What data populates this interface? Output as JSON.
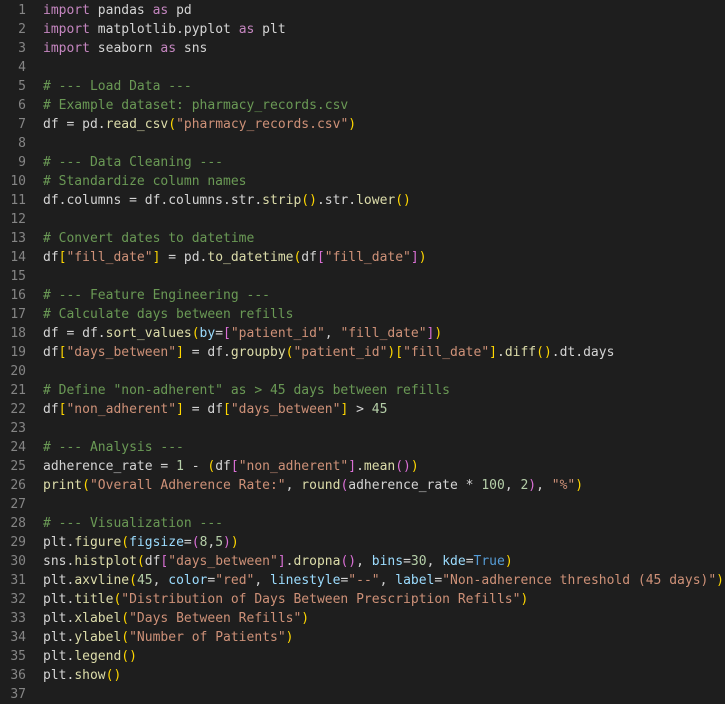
{
  "editor": {
    "lines": [
      {
        "number": "1",
        "tokens": [
          {
            "t": "import",
            "c": "keyword"
          },
          {
            "t": " pandas ",
            "c": "plain"
          },
          {
            "t": "as",
            "c": "keyword"
          },
          {
            "t": " pd",
            "c": "plain"
          }
        ]
      },
      {
        "number": "2",
        "tokens": [
          {
            "t": "import",
            "c": "keyword"
          },
          {
            "t": " matplotlib.pyplot ",
            "c": "plain"
          },
          {
            "t": "as",
            "c": "keyword"
          },
          {
            "t": " plt",
            "c": "plain"
          }
        ]
      },
      {
        "number": "3",
        "tokens": [
          {
            "t": "import",
            "c": "keyword"
          },
          {
            "t": " seaborn ",
            "c": "plain"
          },
          {
            "t": "as",
            "c": "keyword"
          },
          {
            "t": " sns",
            "c": "plain"
          }
        ]
      },
      {
        "number": "4",
        "tokens": []
      },
      {
        "number": "5",
        "tokens": [
          {
            "t": "# --- Load Data ---",
            "c": "comment"
          }
        ]
      },
      {
        "number": "6",
        "tokens": [
          {
            "t": "# Example dataset: pharmacy_records.csv",
            "c": "comment"
          }
        ]
      },
      {
        "number": "7",
        "tokens": [
          {
            "t": "df = pd.",
            "c": "plain"
          },
          {
            "t": "read_csv",
            "c": "function"
          },
          {
            "t": "(",
            "c": "bracket1"
          },
          {
            "t": "\"pharmacy_records.csv\"",
            "c": "string"
          },
          {
            "t": ")",
            "c": "bracket1"
          }
        ]
      },
      {
        "number": "8",
        "tokens": []
      },
      {
        "number": "9",
        "tokens": [
          {
            "t": "# --- Data Cleaning ---",
            "c": "comment"
          }
        ]
      },
      {
        "number": "10",
        "tokens": [
          {
            "t": "# Standardize column names",
            "c": "comment"
          }
        ]
      },
      {
        "number": "11",
        "tokens": [
          {
            "t": "df.columns = df.columns.str.",
            "c": "plain"
          },
          {
            "t": "strip",
            "c": "function"
          },
          {
            "t": "()",
            "c": "bracket1"
          },
          {
            "t": ".str.",
            "c": "plain"
          },
          {
            "t": "lower",
            "c": "function"
          },
          {
            "t": "()",
            "c": "bracket1"
          }
        ]
      },
      {
        "number": "12",
        "tokens": []
      },
      {
        "number": "13",
        "tokens": [
          {
            "t": "# Convert dates to datetime",
            "c": "comment"
          }
        ]
      },
      {
        "number": "14",
        "tokens": [
          {
            "t": "df",
            "c": "plain"
          },
          {
            "t": "[",
            "c": "bracket1"
          },
          {
            "t": "\"fill_date\"",
            "c": "string"
          },
          {
            "t": "]",
            "c": "bracket1"
          },
          {
            "t": " = pd.",
            "c": "plain"
          },
          {
            "t": "to_datetime",
            "c": "function"
          },
          {
            "t": "(",
            "c": "bracket1"
          },
          {
            "t": "df",
            "c": "plain"
          },
          {
            "t": "[",
            "c": "bracket2"
          },
          {
            "t": "\"fill_date\"",
            "c": "string"
          },
          {
            "t": "]",
            "c": "bracket2"
          },
          {
            "t": ")",
            "c": "bracket1"
          }
        ]
      },
      {
        "number": "15",
        "tokens": []
      },
      {
        "number": "16",
        "tokens": [
          {
            "t": "# --- Feature Engineering ---",
            "c": "comment"
          }
        ]
      },
      {
        "number": "17",
        "tokens": [
          {
            "t": "# Calculate days between refills",
            "c": "comment"
          }
        ]
      },
      {
        "number": "18",
        "tokens": [
          {
            "t": "df = df.",
            "c": "plain"
          },
          {
            "t": "sort_values",
            "c": "function"
          },
          {
            "t": "(",
            "c": "bracket1"
          },
          {
            "t": "by",
            "c": "variable"
          },
          {
            "t": "=",
            "c": "plain"
          },
          {
            "t": "[",
            "c": "bracket2"
          },
          {
            "t": "\"patient_id\"",
            "c": "string"
          },
          {
            "t": ", ",
            "c": "plain"
          },
          {
            "t": "\"fill_date\"",
            "c": "string"
          },
          {
            "t": "]",
            "c": "bracket2"
          },
          {
            "t": ")",
            "c": "bracket1"
          }
        ]
      },
      {
        "number": "19",
        "tokens": [
          {
            "t": "df",
            "c": "plain"
          },
          {
            "t": "[",
            "c": "bracket1"
          },
          {
            "t": "\"days_between\"",
            "c": "string"
          },
          {
            "t": "]",
            "c": "bracket1"
          },
          {
            "t": " = df.",
            "c": "plain"
          },
          {
            "t": "groupby",
            "c": "function"
          },
          {
            "t": "(",
            "c": "bracket1"
          },
          {
            "t": "\"patient_id\"",
            "c": "string"
          },
          {
            "t": ")",
            "c": "bracket1"
          },
          {
            "t": "[",
            "c": "bracket1"
          },
          {
            "t": "\"fill_date\"",
            "c": "string"
          },
          {
            "t": "]",
            "c": "bracket1"
          },
          {
            "t": ".",
            "c": "plain"
          },
          {
            "t": "diff",
            "c": "function"
          },
          {
            "t": "()",
            "c": "bracket1"
          },
          {
            "t": ".dt.days",
            "c": "plain"
          }
        ]
      },
      {
        "number": "20",
        "tokens": []
      },
      {
        "number": "21",
        "tokens": [
          {
            "t": "# Define \"non-adherent\" as > 45 days between refills",
            "c": "comment"
          }
        ]
      },
      {
        "number": "22",
        "tokens": [
          {
            "t": "df",
            "c": "plain"
          },
          {
            "t": "[",
            "c": "bracket1"
          },
          {
            "t": "\"non_adherent\"",
            "c": "string"
          },
          {
            "t": "]",
            "c": "bracket1"
          },
          {
            "t": " = df",
            "c": "plain"
          },
          {
            "t": "[",
            "c": "bracket1"
          },
          {
            "t": "\"days_between\"",
            "c": "string"
          },
          {
            "t": "]",
            "c": "bracket1"
          },
          {
            "t": " > ",
            "c": "plain"
          },
          {
            "t": "45",
            "c": "number"
          }
        ]
      },
      {
        "number": "23",
        "tokens": []
      },
      {
        "number": "24",
        "tokens": [
          {
            "t": "# --- Analysis ---",
            "c": "comment"
          }
        ]
      },
      {
        "number": "25",
        "tokens": [
          {
            "t": "adherence_rate = ",
            "c": "plain"
          },
          {
            "t": "1",
            "c": "number"
          },
          {
            "t": " - ",
            "c": "plain"
          },
          {
            "t": "(",
            "c": "bracket1"
          },
          {
            "t": "df",
            "c": "plain"
          },
          {
            "t": "[",
            "c": "bracket2"
          },
          {
            "t": "\"non_adherent\"",
            "c": "string"
          },
          {
            "t": "]",
            "c": "bracket2"
          },
          {
            "t": ".",
            "c": "plain"
          },
          {
            "t": "mean",
            "c": "function"
          },
          {
            "t": "()",
            "c": "bracket2"
          },
          {
            "t": ")",
            "c": "bracket1"
          }
        ]
      },
      {
        "number": "26",
        "tokens": [
          {
            "t": "print",
            "c": "function"
          },
          {
            "t": "(",
            "c": "bracket1"
          },
          {
            "t": "\"Overall Adherence Rate:\"",
            "c": "string"
          },
          {
            "t": ", ",
            "c": "plain"
          },
          {
            "t": "round",
            "c": "function"
          },
          {
            "t": "(",
            "c": "bracket2"
          },
          {
            "t": "adherence_rate * ",
            "c": "plain"
          },
          {
            "t": "100",
            "c": "number"
          },
          {
            "t": ", ",
            "c": "plain"
          },
          {
            "t": "2",
            "c": "number"
          },
          {
            "t": ")",
            "c": "bracket2"
          },
          {
            "t": ", ",
            "c": "plain"
          },
          {
            "t": "\"%\"",
            "c": "string"
          },
          {
            "t": ")",
            "c": "bracket1"
          }
        ]
      },
      {
        "number": "27",
        "tokens": []
      },
      {
        "number": "28",
        "tokens": [
          {
            "t": "# --- Visualization ---",
            "c": "comment"
          }
        ]
      },
      {
        "number": "29",
        "tokens": [
          {
            "t": "plt.",
            "c": "plain"
          },
          {
            "t": "figure",
            "c": "function"
          },
          {
            "t": "(",
            "c": "bracket1"
          },
          {
            "t": "figsize",
            "c": "variable"
          },
          {
            "t": "=",
            "c": "plain"
          },
          {
            "t": "(",
            "c": "bracket2"
          },
          {
            "t": "8",
            "c": "number"
          },
          {
            "t": ",",
            "c": "plain"
          },
          {
            "t": "5",
            "c": "number"
          },
          {
            "t": ")",
            "c": "bracket2"
          },
          {
            "t": ")",
            "c": "bracket1"
          }
        ]
      },
      {
        "number": "30",
        "tokens": [
          {
            "t": "sns.",
            "c": "plain"
          },
          {
            "t": "histplot",
            "c": "function"
          },
          {
            "t": "(",
            "c": "bracket1"
          },
          {
            "t": "df",
            "c": "plain"
          },
          {
            "t": "[",
            "c": "bracket2"
          },
          {
            "t": "\"days_between\"",
            "c": "string"
          },
          {
            "t": "]",
            "c": "bracket2"
          },
          {
            "t": ".",
            "c": "plain"
          },
          {
            "t": "dropna",
            "c": "function"
          },
          {
            "t": "()",
            "c": "bracket2"
          },
          {
            "t": ", ",
            "c": "plain"
          },
          {
            "t": "bins",
            "c": "variable"
          },
          {
            "t": "=",
            "c": "plain"
          },
          {
            "t": "30",
            "c": "number"
          },
          {
            "t": ", ",
            "c": "plain"
          },
          {
            "t": "kde",
            "c": "variable"
          },
          {
            "t": "=",
            "c": "plain"
          },
          {
            "t": "True",
            "c": "constant"
          },
          {
            "t": ")",
            "c": "bracket1"
          }
        ]
      },
      {
        "number": "31",
        "tokens": [
          {
            "t": "plt.",
            "c": "plain"
          },
          {
            "t": "axvline",
            "c": "function"
          },
          {
            "t": "(",
            "c": "bracket1"
          },
          {
            "t": "45",
            "c": "number"
          },
          {
            "t": ", ",
            "c": "plain"
          },
          {
            "t": "color",
            "c": "variable"
          },
          {
            "t": "=",
            "c": "plain"
          },
          {
            "t": "\"red\"",
            "c": "string"
          },
          {
            "t": ", ",
            "c": "plain"
          },
          {
            "t": "linestyle",
            "c": "variable"
          },
          {
            "t": "=",
            "c": "plain"
          },
          {
            "t": "\"--\"",
            "c": "string"
          },
          {
            "t": ", ",
            "c": "plain"
          },
          {
            "t": "label",
            "c": "variable"
          },
          {
            "t": "=",
            "c": "plain"
          },
          {
            "t": "\"Non-adherence threshold (45 days)\"",
            "c": "string"
          },
          {
            "t": ")",
            "c": "bracket1"
          }
        ]
      },
      {
        "number": "32",
        "tokens": [
          {
            "t": "plt.",
            "c": "plain"
          },
          {
            "t": "title",
            "c": "function"
          },
          {
            "t": "(",
            "c": "bracket1"
          },
          {
            "t": "\"Distribution of Days Between Prescription Refills\"",
            "c": "string"
          },
          {
            "t": ")",
            "c": "bracket1"
          }
        ]
      },
      {
        "number": "33",
        "tokens": [
          {
            "t": "plt.",
            "c": "plain"
          },
          {
            "t": "xlabel",
            "c": "function"
          },
          {
            "t": "(",
            "c": "bracket1"
          },
          {
            "t": "\"Days Between Refills\"",
            "c": "string"
          },
          {
            "t": ")",
            "c": "bracket1"
          }
        ]
      },
      {
        "number": "34",
        "tokens": [
          {
            "t": "plt.",
            "c": "plain"
          },
          {
            "t": "ylabel",
            "c": "function"
          },
          {
            "t": "(",
            "c": "bracket1"
          },
          {
            "t": "\"Number of Patients\"",
            "c": "string"
          },
          {
            "t": ")",
            "c": "bracket1"
          }
        ]
      },
      {
        "number": "35",
        "tokens": [
          {
            "t": "plt.",
            "c": "plain"
          },
          {
            "t": "legend",
            "c": "function"
          },
          {
            "t": "()",
            "c": "bracket1"
          }
        ]
      },
      {
        "number": "36",
        "tokens": [
          {
            "t": "plt.",
            "c": "plain"
          },
          {
            "t": "show",
            "c": "function"
          },
          {
            "t": "()",
            "c": "bracket1"
          }
        ]
      },
      {
        "number": "37",
        "tokens": []
      }
    ]
  },
  "colors": {
    "background": "#1e1e1e",
    "gutter": "#858585",
    "plain": "#d4d4d4",
    "keyword": "#c586c0",
    "string": "#ce9178",
    "comment": "#6a9955",
    "number": "#b5cea8",
    "function": "#dcdcaa",
    "variable": "#9cdcfe",
    "constant": "#569cd6",
    "bracket1": "#ffd700",
    "bracket2": "#da70d6"
  }
}
